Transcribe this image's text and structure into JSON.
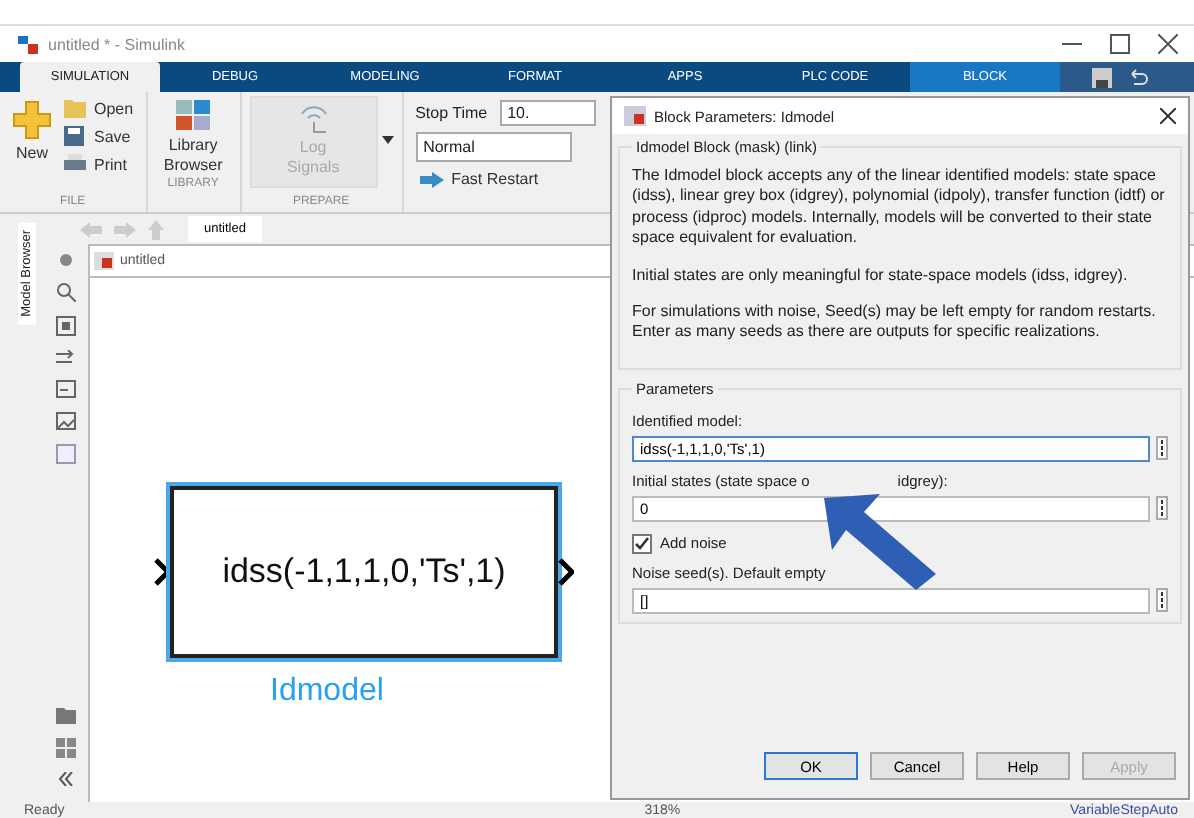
{
  "window": {
    "title": "untitled * - Simulink"
  },
  "ribbon_tabs": [
    {
      "label": "SIMULATION",
      "selected": true,
      "contextual": false
    },
    {
      "label": "DEBUG",
      "selected": false,
      "contextual": false
    },
    {
      "label": "MODELING",
      "selected": false,
      "contextual": false
    },
    {
      "label": "FORMAT",
      "selected": false,
      "contextual": false
    },
    {
      "label": "APPS",
      "selected": false,
      "contextual": false
    },
    {
      "label": "PLC CODE",
      "selected": false,
      "contextual": false
    },
    {
      "label": "BLOCK",
      "selected": false,
      "contextual": true
    }
  ],
  "ribbon": {
    "file": {
      "new": "New",
      "items": [
        {
          "label": "Open"
        },
        {
          "label": "Save"
        },
        {
          "label": "Print"
        }
      ],
      "group": "FILE"
    },
    "library": {
      "button": "Library Browser",
      "group": "LIBRARY"
    },
    "prepare": {
      "button": "Log Signals",
      "disabled": true,
      "group": "PREPARE"
    },
    "simulate": {
      "stop_time_label": "Stop Time",
      "stop_time": "10.",
      "mode": "Normal",
      "fast_restart": "Fast Restart"
    }
  },
  "explorer": {
    "side_tab": "Model Browser",
    "tab": "untitled",
    "address": "untitled"
  },
  "block": {
    "text": "idss(-1,1,1,0,'Ts',1)",
    "name": "Idmodel",
    "selected": true
  },
  "status_bar": {
    "left": "Ready",
    "zoom": "318%",
    "solver": "VariableStepAuto"
  },
  "dialog": {
    "title": "Block Parameters: Idmodel",
    "group": "Idmodel Block (mask) (link)",
    "paragraphs": [
      "The Idmodel block accepts any of the linear identified models: state space (idss), linear grey box (idgrey), polynomial (idpoly), transfer function (idtf) or process (idproc) models. Internally, models will be converted to their state space equivalent for evaluation.",
      "Initial states are only meaningful for state-space models (idss, idgrey).",
      "For simulations with noise, Seed(s) may be left empty for random restarts.\nEnter as many seeds as there are outputs for specific realizations."
    ],
    "parameters": {
      "title": "Parameters",
      "fields": [
        {
          "kind": "text",
          "label": "Identified model:",
          "value": "idss(-1,1,1,0,'Ts',1)"
        },
        {
          "kind": "text",
          "label": "Initial states (state space o",
          "label_tail": "idgrey):",
          "value": "0"
        },
        {
          "kind": "checkbox",
          "label": "Add noise",
          "checked": true
        },
        {
          "kind": "text",
          "label": "Noise seed(s). Default empty",
          "value": "[]"
        }
      ]
    },
    "buttons": [
      {
        "label": "OK",
        "default": true,
        "disabled": false
      },
      {
        "label": "Cancel",
        "default": false,
        "disabled": false
      },
      {
        "label": "Help",
        "default": false,
        "disabled": false
      },
      {
        "label": "Apply",
        "default": false,
        "disabled": true
      }
    ]
  }
}
